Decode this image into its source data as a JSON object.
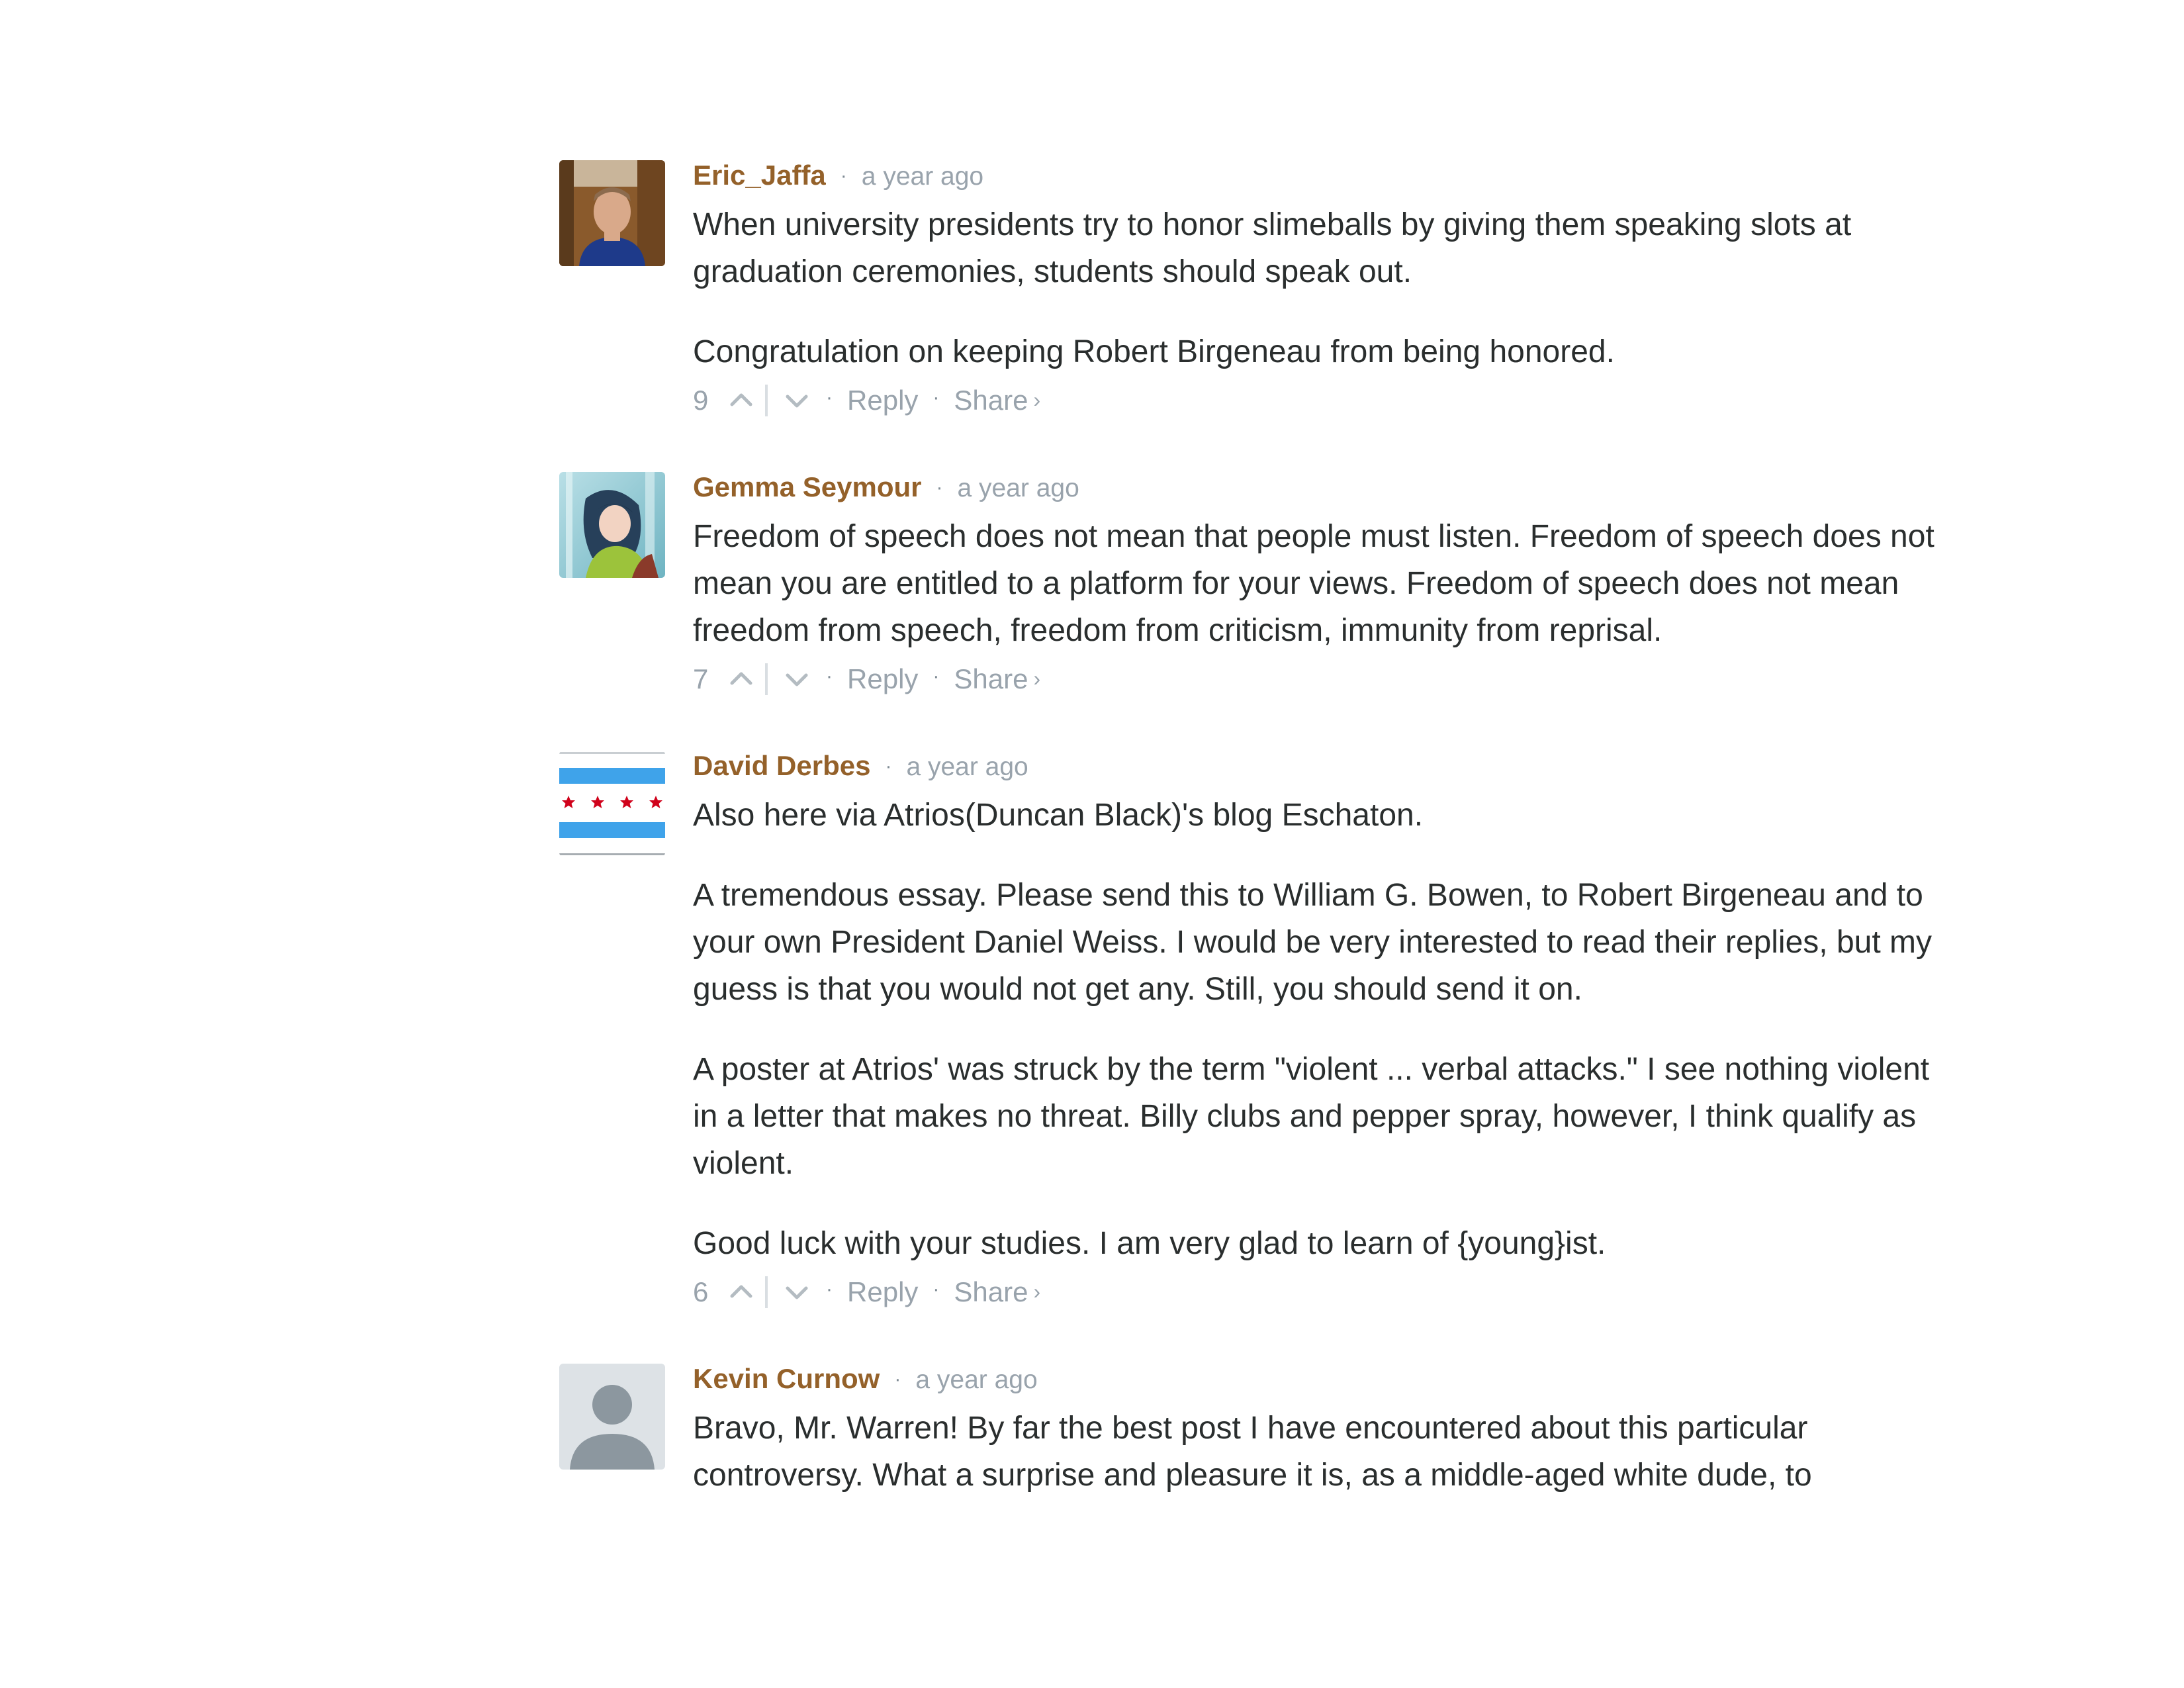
{
  "comments": [
    {
      "author": "Eric_Jaffa",
      "time": "a year ago",
      "avatar": "photo-icon",
      "paragraphs": [
        "When university presidents try to honor slimeballs by giving them speaking slots at graduation ceremonies, students should speak out.",
        "Congratulation on keeping Robert Birgeneau from being honored."
      ],
      "votes": "9"
    },
    {
      "author": "Gemma Seymour",
      "time": "a year ago",
      "avatar": "illustration-icon",
      "paragraphs": [
        "Freedom of speech does not mean that people must listen. Freedom of speech does not mean you are entitled to a platform for your views. Freedom of speech does not mean freedom from speech, freedom from criticism, immunity from reprisal."
      ],
      "votes": "7"
    },
    {
      "author": "David Derbes",
      "time": "a year ago",
      "avatar": "chicago-flag-icon",
      "paragraphs": [
        "Also here via Atrios(Duncan Black)'s blog Eschaton.",
        "A tremendous essay. Please send this to William G. Bowen, to Robert Birgeneau and to your own President Daniel Weiss. I would be very interested to read their replies, but my guess is that you would not get any. Still, you should send it on.",
        "A poster at Atrios' was struck by the term \"violent ... verbal attacks.\" I see nothing violent in a letter that makes no threat. Billy clubs and pepper spray, however, I think qualify as violent.",
        "Good luck with your studies. I am very glad to learn of {young}ist."
      ],
      "votes": "6"
    },
    {
      "author": "Kevin Curnow",
      "time": "a year ago",
      "avatar": "default-user-icon",
      "paragraphs": [
        "Bravo, Mr. Warren! By far the best post I have encountered about this particular controversy. What a surprise and pleasure it is, as a middle-aged white dude, to"
      ],
      "votes": ""
    }
  ],
  "labels": {
    "bullet": "·",
    "reply": "Reply",
    "share": "Share",
    "share_arrow": "›"
  },
  "colors": {
    "author": "#94612a",
    "meta": "#99a3ac",
    "text": "#2a2e2e"
  }
}
